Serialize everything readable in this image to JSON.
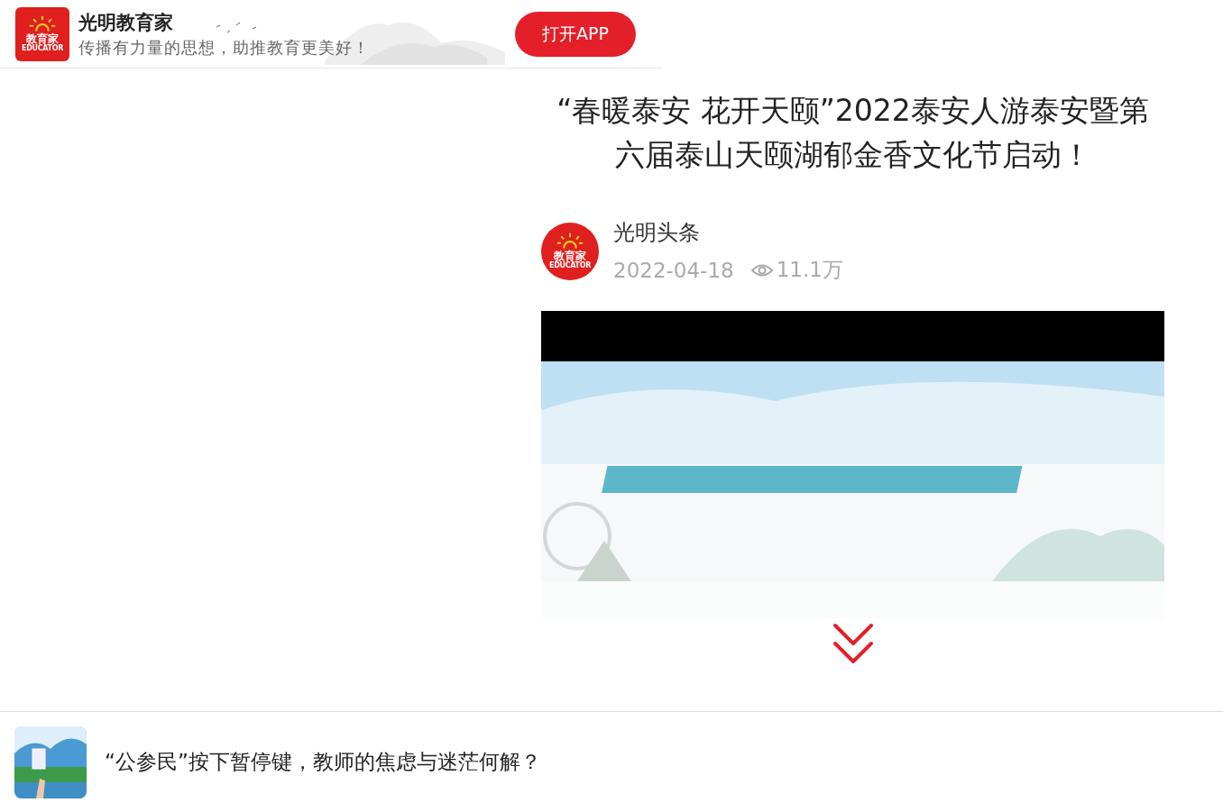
{
  "app_banner": {
    "logo": {
      "main": "教育家",
      "sub": "EDUCATOR"
    },
    "name": "光明教育家",
    "slogan": "传播有力量的思想，助推教育更美好！",
    "open_button": "打开APP"
  },
  "article": {
    "title": "“春暖泰安 花开天颐”2022泰安人游泰安暨第六届泰山天颐湖郁金香文化节启动！",
    "author": {
      "avatar": {
        "main": "教育家",
        "sub": "EDUCATOR"
      },
      "name": "光明头条",
      "date": "2022-04-18",
      "views": "11.1万"
    }
  },
  "recommendation": {
    "title": "“公参民”按下暂停键，教师的焦虑与迷茫何解？"
  }
}
